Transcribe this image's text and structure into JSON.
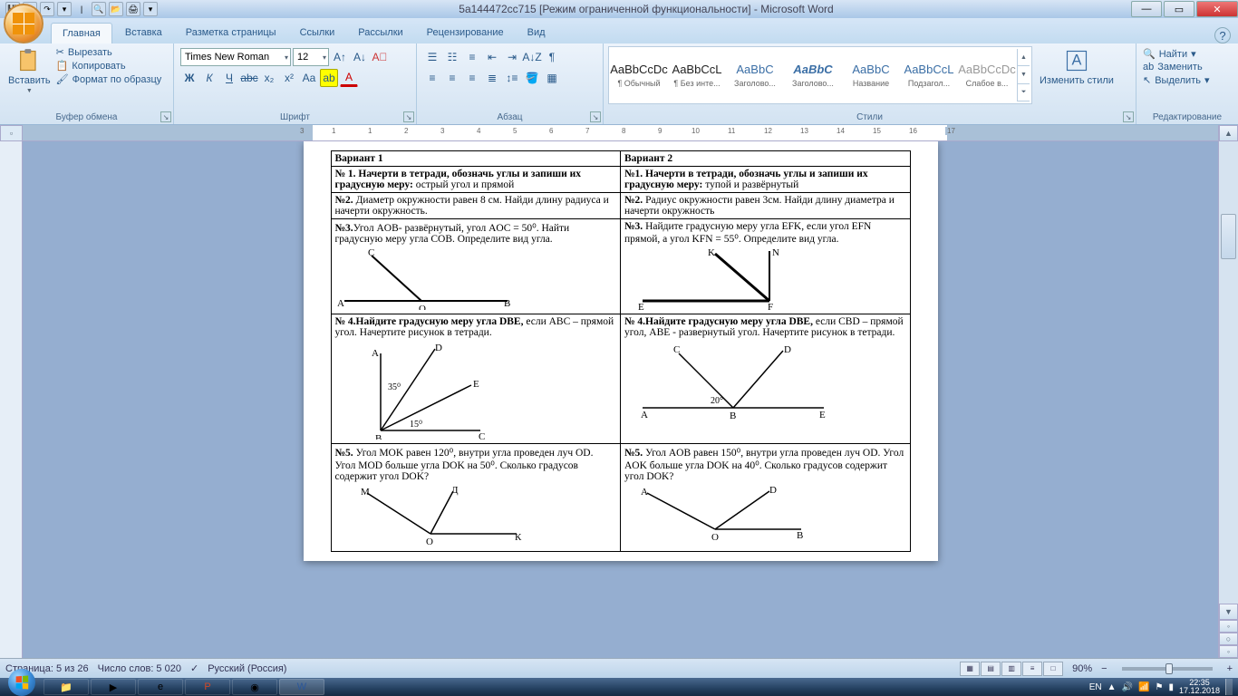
{
  "chrome": {
    "title": "5a144472cc715 [Режим ограниченной функциональности] - Microsoft Word"
  },
  "tabs": {
    "home": "Главная",
    "insert": "Вставка",
    "page_layout": "Разметка страницы",
    "references": "Ссылки",
    "mailings": "Рассылки",
    "review": "Рецензирование",
    "view": "Вид"
  },
  "ribbon": {
    "paste": "Вставить",
    "cut": "Вырезать",
    "copy": "Копировать",
    "format_painter": "Формат по образцу",
    "clipboard_group": "Буфер обмена",
    "font_group": "Шрифт",
    "para_group": "Абзац",
    "styles_group": "Стили",
    "edit_group": "Редактирование",
    "font_name": "Times New Roman",
    "font_size": "12",
    "change_styles": "Изменить стили",
    "find": "Найти",
    "replace": "Заменить",
    "select": "Выделить",
    "styles": [
      {
        "prev": "AaBbCcDc",
        "name": "¶ Обычный",
        "cls": ""
      },
      {
        "prev": "AaBbCcL",
        "name": "¶ Без инте...",
        "cls": ""
      },
      {
        "prev": "AaBbC",
        "name": "Заголово...",
        "cls": "blue"
      },
      {
        "prev": "AaBbC",
        "name": "Заголово...",
        "cls": "blue bold"
      },
      {
        "prev": "AaBbC",
        "name": "Название",
        "cls": "blue"
      },
      {
        "prev": "AaBbCcL",
        "name": "Подзагол...",
        "cls": "blue"
      },
      {
        "prev": "AaBbCcDc",
        "name": "Слабое в...",
        "cls": "gray"
      }
    ]
  },
  "document": {
    "v1_title": "Вариант 1",
    "v2_title": "Вариант 2",
    "v1_n1": "№ 1.  Начерти в тетради, обозначь углы и запиши их градусную меру: ",
    "v1_n1_tail": "острый угол и прямой",
    "v2_n1": "№1.  Начерти в тетради, обозначь углы и запиши их градусную меру: ",
    "v2_n1_tail": "тупой и развёрнутый",
    "v1_n2": "№2. ",
    "v1_n2_body": "Диаметр окружности равен 8 см. Найди длину радиуса и начерти окружность.",
    "v2_n2": "№2. ",
    "v2_n2_body": "Радиус окружности равен 3см. Найди длину диаметра и начерти окружность",
    "v1_n3": "№3.",
    "v1_n3_body": "Угол AOB- развёрнутый, угол AOC = 50⁰. Найти градусную меру угла COB. Определите вид угла.",
    "v2_n3": "№3. ",
    "v2_n3_body": "Найдите градусную меру угла EFK, если угол EFN прямой, а угол KFN = 55⁰. Определите вид угла.",
    "v1_n4": "№ 4.Найдите градусную меру угла DBE, ",
    "v1_n4_body": "если ABC – прямой угол. Начертите рисунок в тетради.",
    "v2_n4": "№ 4.Найдите градусную меру угла DBE, ",
    "v2_n4_body": "если CBD – прямой угол, ABE - развернутый угол. Начертите рисунок в тетради.",
    "v1_n5": "№5. ",
    "v1_n5_body": "Угол MOK равен 120⁰, внутри  угла проведен луч OD. Угол MOD больше угла DOK  на 50⁰. Сколько градусов содержит угол DOK?",
    "v2_n5": "№5. ",
    "v2_n5_body": "Угол AOB равен 150⁰, внутри угла проведен луч OD. Угол AOK больше угла DOK на 40⁰. Сколько градусов содержит угол DOK?",
    "labels": {
      "A": "A",
      "B": "B",
      "C": "C",
      "D": "D",
      "E": "E",
      "F": "F",
      "K": "K",
      "N": "N",
      "O": "O",
      "M": "М",
      "Dru": "Д",
      "Kru": "К",
      "a35": "35⁰",
      "a15": "15⁰",
      "a20": "20°"
    }
  },
  "status": {
    "page": "Страница: 5 из 26",
    "words": "Число слов: 5 020",
    "lang": "Русский (Россия)",
    "zoom": "90%"
  },
  "taskbar": {
    "lang": "EN",
    "time": "22:35",
    "date": "17.12.2018"
  }
}
